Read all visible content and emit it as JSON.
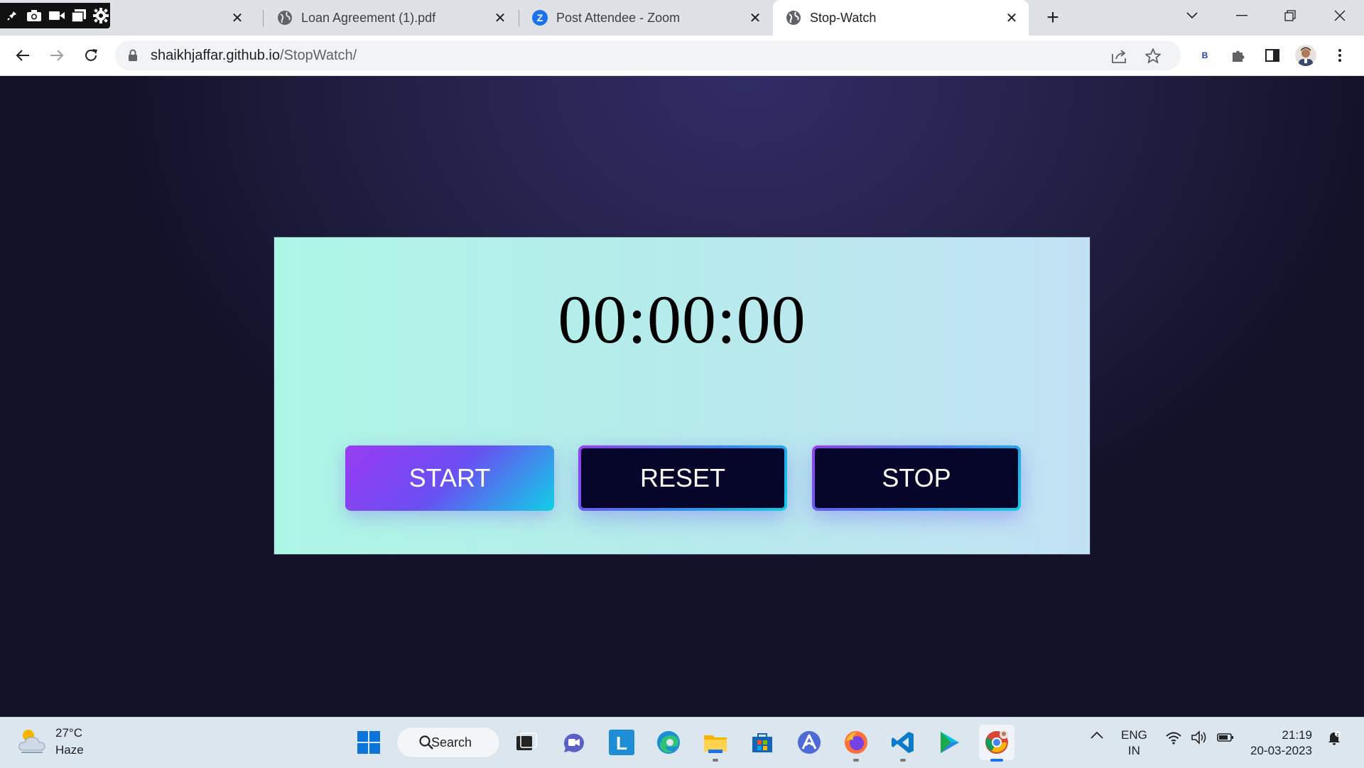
{
  "capture_toolbar": {
    "icons": [
      "pin-icon",
      "camera-icon",
      "video-icon",
      "window-icon",
      "settings-icon"
    ]
  },
  "tabs": [
    {
      "title": "Loan Agreement (1).pdf",
      "icon": "globe-icon",
      "active": false
    },
    {
      "title": "Post Attendee - Zoom",
      "icon": "zoom-icon",
      "active": false
    },
    {
      "title": "Stop-Watch",
      "icon": "globe-icon",
      "active": true
    }
  ],
  "tab_close_glyph": "✕",
  "new_tab_glyph": "+",
  "window_controls": {
    "dropdown": "⌵",
    "minimize": "—",
    "restore": "❐",
    "close": "✕"
  },
  "address_bar": {
    "host": "shaikhjaffar.github.io",
    "path": "/StopWatch/"
  },
  "extension_badge": "B",
  "stopwatch": {
    "display": "00:00:00",
    "buttons": {
      "start": "START",
      "reset": "RESET",
      "stop": "STOP"
    }
  },
  "taskbar": {
    "weather": {
      "temp": "27°C",
      "condition": "Haze"
    },
    "search_label": "Search",
    "language": {
      "line1": "ENG",
      "line2": "IN"
    },
    "clock": {
      "time": "21:19",
      "date": "20-03-2023"
    }
  },
  "colors": {
    "tab_strip": "#dee1e6",
    "page_bg": "#27244f",
    "card_bg_start": "#adf6e6",
    "card_bg_end": "#c2e2f4",
    "button_dark": "#06052a",
    "accent_purple": "#9a3cf2",
    "accent_cyan": "#10cfe6"
  }
}
